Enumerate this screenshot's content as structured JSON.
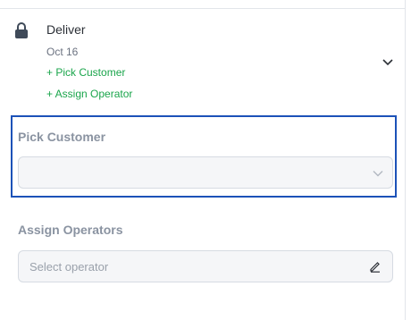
{
  "step": {
    "title": "Deliver",
    "date": "Oct 16",
    "actions": [
      "+ Pick Customer",
      "+ Assign Operator"
    ],
    "lock_icon": "lock-icon",
    "expand_icon": "chevron-down-icon"
  },
  "pick_customer": {
    "label": "Pick Customer",
    "value": "",
    "dropdown_icon": "chevron-down-icon"
  },
  "assign_operators": {
    "label": "Assign Operators",
    "placeholder": "Select operator",
    "edit_icon": "pencil-icon"
  },
  "colors": {
    "accent_link": "#1aa54b",
    "focus_border": "#1c52b8",
    "label_gray": "#8a93a1"
  }
}
